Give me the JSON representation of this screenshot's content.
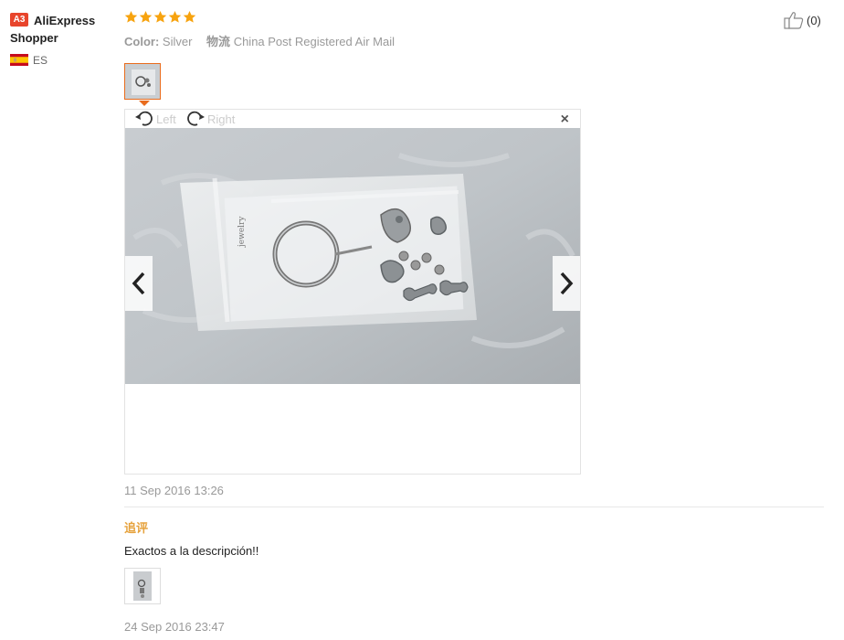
{
  "reviewer": {
    "badge": "A3",
    "name": "AliExpress Shopper",
    "country": "ES"
  },
  "rating": {
    "stars": 5,
    "star_color": "#f7a30f"
  },
  "attributes": {
    "color_label": "Color:",
    "color_value": "Silver",
    "shipping_label": "物流",
    "shipping_value": "China Post Registered Air Mail"
  },
  "likes": {
    "count": "(0)"
  },
  "viewer": {
    "rotate_left": "Left",
    "rotate_right": "Right",
    "close": "×",
    "accent": "#e96c1d"
  },
  "review": {
    "date": "11 Sep 2016 13:26"
  },
  "followup": {
    "label": "追评",
    "text": "Exactos a la descripción!!",
    "date": "24 Sep 2016 23:47"
  }
}
